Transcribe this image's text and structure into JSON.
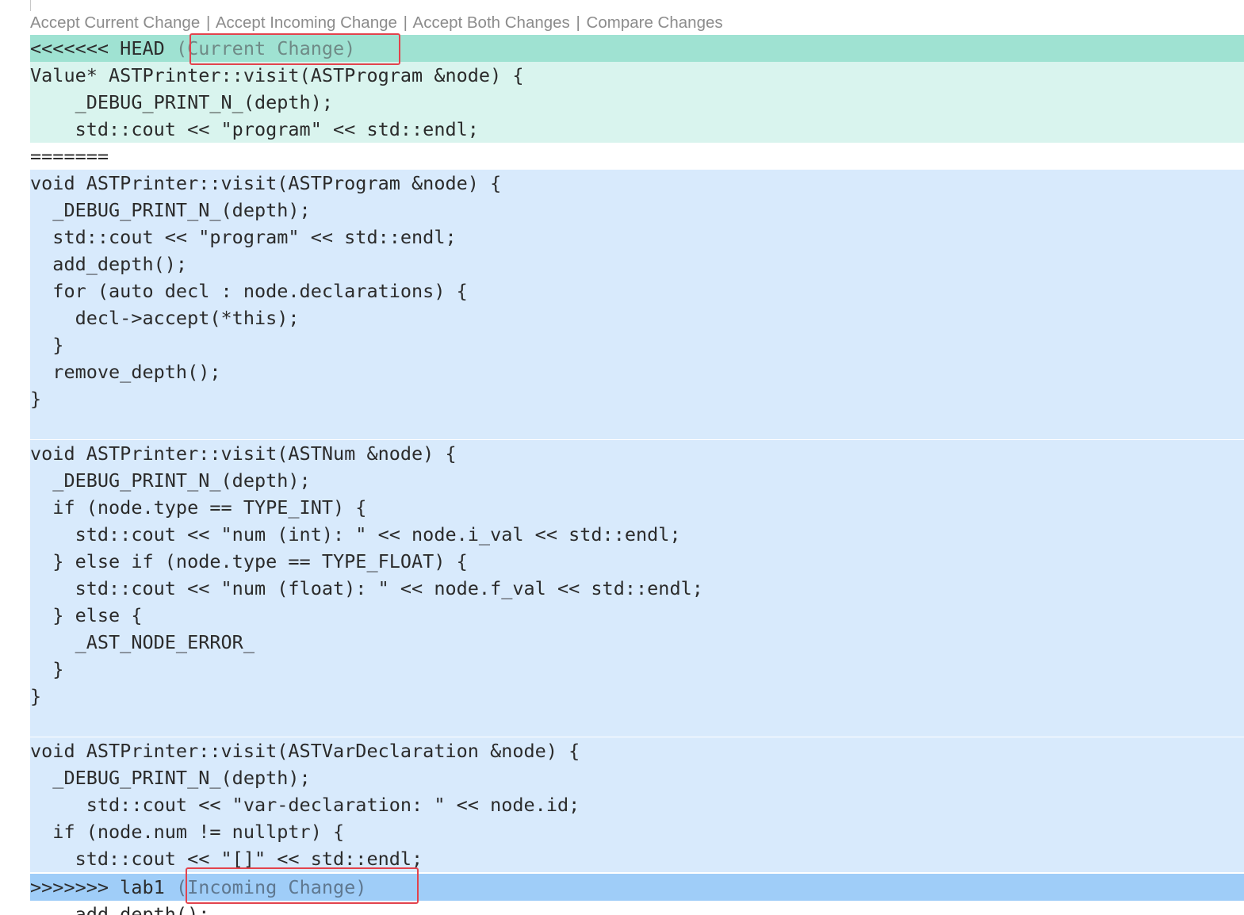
{
  "codelens": {
    "accept_current": "Accept Current Change",
    "accept_incoming": "Accept Incoming Change",
    "accept_both": "Accept Both Changes",
    "compare": "Compare Changes",
    "separator": "|"
  },
  "colors": {
    "current_header": "#9fe2d2",
    "current_body": "#d9f4ee",
    "incoming_body": "#d8eafc",
    "incoming_header": "#9fcdf8",
    "highlight_box": "#e2434d"
  },
  "conflict": {
    "current_marker": "<<<<<<< HEAD",
    "current_hint": "(Current Change)",
    "divider": "=======",
    "incoming_marker": ">>>>>>> lab1",
    "incoming_hint": "(Incoming Change)"
  },
  "lines": {
    "c1": "Value* ASTPrinter::visit(ASTProgram &node) {",
    "c2": "    _DEBUG_PRINT_N_(depth);",
    "c3": "    std::cout << \"program\" << std::endl;",
    "i1": "void ASTPrinter::visit(ASTProgram &node) {",
    "i2": "  _DEBUG_PRINT_N_(depth);",
    "i3": "  std::cout << \"program\" << std::endl;",
    "i4": "  add_depth();",
    "i5": "  for (auto decl : node.declarations) {",
    "i6": "    decl->accept(*this);",
    "i7": "  }",
    "i8": "  remove_depth();",
    "i9": "}",
    "i10": "",
    "i11": "void ASTPrinter::visit(ASTNum &node) {",
    "i12": "  _DEBUG_PRINT_N_(depth);",
    "i13": "  if (node.type == TYPE_INT) {",
    "i14": "    std::cout << \"num (int): \" << node.i_val << std::endl;",
    "i15": "  } else if (node.type == TYPE_FLOAT) {",
    "i16": "    std::cout << \"num (float): \" << node.f_val << std::endl;",
    "i17": "  } else {",
    "i18": "    _AST_NODE_ERROR_",
    "i19": "  }",
    "i20": "}",
    "i21": "",
    "i22": "void ASTPrinter::visit(ASTVarDeclaration &node) {",
    "i23": "  _DEBUG_PRINT_N_(depth);",
    "i24": "     std::cout << \"var-declaration: \" << node.id;",
    "i25": "  if (node.num != nullptr) {",
    "i26": "    std::cout << \"[]\" << std::endl;",
    "after1": "    add_depth();"
  }
}
